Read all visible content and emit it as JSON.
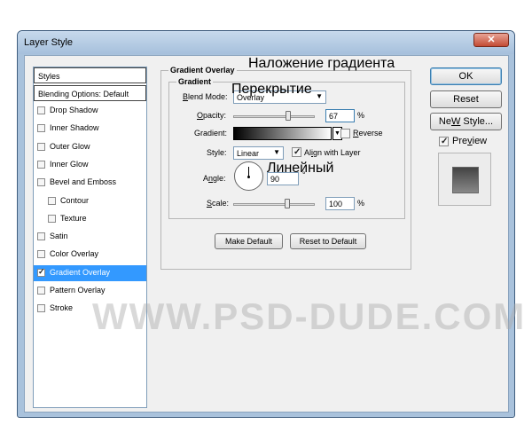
{
  "window": {
    "title": "Layer Style",
    "close_icon": "close-icon"
  },
  "sidebar": {
    "header": "Styles",
    "blending": "Blending Options: Default",
    "items": [
      {
        "label": "Drop Shadow",
        "checked": false,
        "indent": false
      },
      {
        "label": "Inner Shadow",
        "checked": false,
        "indent": false
      },
      {
        "label": "Outer Glow",
        "checked": false,
        "indent": false
      },
      {
        "label": "Inner Glow",
        "checked": false,
        "indent": false
      },
      {
        "label": "Bevel and Emboss",
        "checked": false,
        "indent": false
      },
      {
        "label": "Contour",
        "checked": false,
        "indent": true
      },
      {
        "label": "Texture",
        "checked": false,
        "indent": true
      },
      {
        "label": "Satin",
        "checked": false,
        "indent": false
      },
      {
        "label": "Color Overlay",
        "checked": false,
        "indent": false
      },
      {
        "label": "Gradient Overlay",
        "checked": true,
        "indent": false,
        "selected": true
      },
      {
        "label": "Pattern Overlay",
        "checked": false,
        "indent": false
      },
      {
        "label": "Stroke",
        "checked": false,
        "indent": false
      }
    ]
  },
  "panel": {
    "outer_title": "Gradient Overlay",
    "inner_title": "Gradient",
    "blend_mode": {
      "label_u": "B",
      "label_rest": "lend Mode:",
      "value": "Overlay"
    },
    "opacity": {
      "label_u": "O",
      "label_rest": "pacity:",
      "value": "67",
      "unit": "%",
      "level": 67
    },
    "gradient": {
      "label": "Gradient:",
      "reverse_u": "R",
      "reverse_rest": "everse",
      "reverse_checked": false
    },
    "style": {
      "label": "Style:",
      "value": "Linear",
      "align_u": "i",
      "align_pre": "Al",
      "align_rest": "gn with Layer",
      "align_checked": true
    },
    "angle": {
      "label_u": "n",
      "label_pre": "A",
      "label_rest": "gle:",
      "value": "90",
      "unit": "°"
    },
    "scale": {
      "label_u": "S",
      "label_rest": "cale:",
      "value": "100",
      "unit": "%",
      "level": 100
    },
    "make_default": "Make Default",
    "reset_default": "Reset to Default"
  },
  "buttons": {
    "ok": "OK",
    "reset": "Reset",
    "new_style_u": "W",
    "new_style_pre": "Ne",
    "new_style_rest": " Style...",
    "preview_u": "v",
    "preview_pre": "Pre",
    "preview_rest": "iew",
    "preview_checked": true
  },
  "annotations": {
    "gradient_overlay": "Наложение градиента",
    "overlay": "Перекрытие",
    "linear": "Линейный"
  },
  "watermark": "WWW.PSD-DUDE.COM",
  "colors": {
    "selection": "#3399ff",
    "titlebar": "#a9c2dc",
    "close": "#c34b34"
  }
}
